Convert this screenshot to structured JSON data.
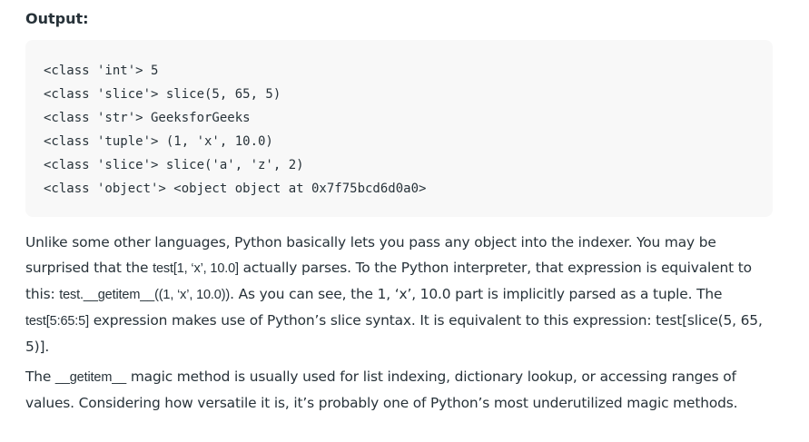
{
  "heading": "Output:",
  "code_lines": [
    "<class 'int'> 5",
    "<class 'slice'> slice(5, 65, 5)",
    "<class 'str'> GeeksforGeeks",
    "<class 'tuple'> (1, 'x', 10.0)",
    "<class 'slice'> slice('a', 'z', 2)",
    "<class 'object'> <object object at 0x7f75bcd6d0a0>"
  ],
  "paragraph1": {
    "t1": "Unlike some other languages, Python basically lets you pass any object into the indexer. You may be surprised that the ",
    "c1": "test[1, ‘x’, 10.0]",
    "t2": " actually parses. To the Python interpreter, that expression is equivalent to this: ",
    "c2": "test.__getitem__((1, ‘x’, 10.0))",
    "t3": ". As you can see, the 1, ‘x’, 10.0 part is implicitly parsed as a tuple. The ",
    "c3": "test[5:65:5]",
    "t4": " expression makes use of Python’s slice syntax. It is equivalent to this expression: test[slice(5, 65, 5)]."
  },
  "paragraph2": {
    "t1": "The ",
    "c1": "__getitem__",
    "t2": " magic method is usually used for list indexing, dictionary lookup, or accessing ranges of values. Considering how versatile it is, it’s probably one of Python’s most underutilized magic methods."
  }
}
